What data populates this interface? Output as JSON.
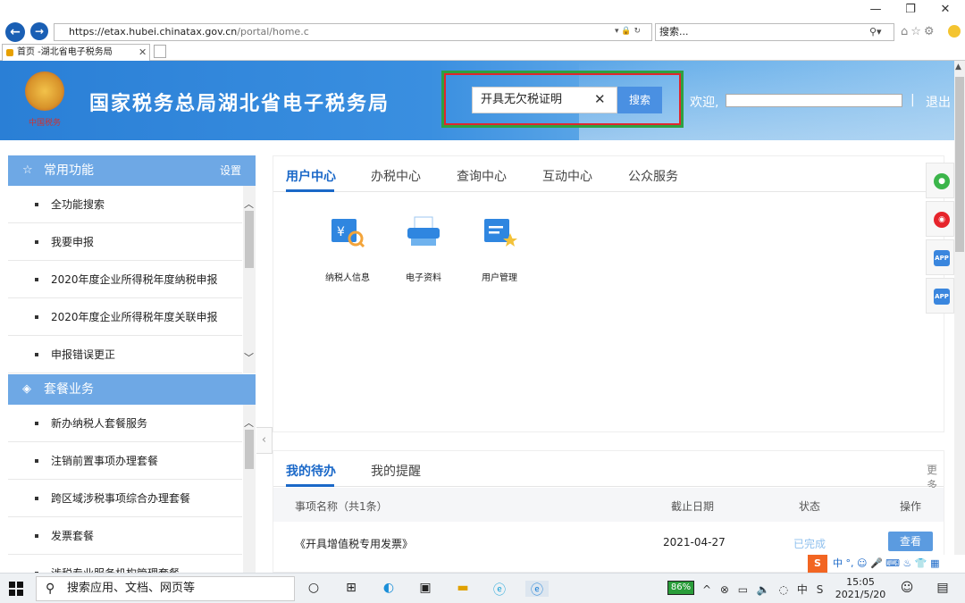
{
  "browser": {
    "url_prefix": "https://",
    "url_host": "etax.hubei.chinatax.gov.cn",
    "url_path": "/portal/home.c",
    "search_placeholder": "搜索...",
    "tab_title": "首页 -湖北省电子税务局",
    "min_glyph": "—",
    "max_glyph": "❐",
    "close_glyph": "✕",
    "back_glyph": "←",
    "forward_glyph": "→"
  },
  "header": {
    "emblem_caption": "中国税务",
    "title": "国家税务总局湖北省电子税务局",
    "search_value": "开具无欠税证明",
    "clear_glyph": "✕",
    "search_button": "搜索",
    "welcome": "欢迎,",
    "separator": "|",
    "logout": "退出"
  },
  "sidebar": {
    "section1": {
      "title": "常用功能",
      "action": "设置",
      "icon": "star-icon"
    },
    "section1_items": [
      "全功能搜索",
      "我要申报",
      "2020年度企业所得税年度纳税申报",
      "2020年度企业所得税年度关联申报",
      "申报错误更正"
    ],
    "section2": {
      "title": "套餐业务",
      "icon": "layers-icon"
    },
    "section2_items": [
      "新办纳税人套餐服务",
      "注销前置事项办理套餐",
      "跨区域涉税事项综合办理套餐",
      "发票套餐",
      "涉税专业服务机构管理套餐"
    ]
  },
  "main": {
    "tabs": [
      "用户中心",
      "办税中心",
      "查询中心",
      "互动中心",
      "公众服务"
    ],
    "functions": [
      {
        "label": "纳税人信息",
        "icon": "taxpayer-info-icon"
      },
      {
        "label": "电子资料",
        "icon": "electronic-docs-icon"
      },
      {
        "label": "用户管理",
        "icon": "user-management-icon"
      }
    ]
  },
  "todo": {
    "tabs": [
      "我的待办",
      "我的提醒"
    ],
    "more": "更多",
    "columns": [
      "事项名称（共1条）",
      "截止日期",
      "状态",
      "操作"
    ],
    "rows": [
      {
        "name": "《开具增值税专用发票》",
        "deadline": "2021-04-27",
        "status": "已完成",
        "action": "查看"
      }
    ]
  },
  "float_icons": [
    "wechat-icon",
    "weibo-icon",
    "app-icon",
    "app-icon"
  ],
  "float_labels": {
    "app": "APP"
  },
  "ime": {
    "text": "中 °, ☺ 🎤 ⌨ ♨ 👕 ▦"
  },
  "taskbar": {
    "search_placeholder": "搜索应用、文档、网页等",
    "battery": "86%",
    "time": "15:05",
    "date": "2021/5/20",
    "tray": "^ ⊗ ▭ 🔈 ◌ 中 S"
  },
  "colors": {
    "accent": "#1a68c8",
    "banner": "#2a7fd6",
    "sidebar_header": "#6ea8e5",
    "highlight_red": "#e0262d",
    "highlight_green": "#2ea043",
    "done": "#5aa0e6"
  }
}
